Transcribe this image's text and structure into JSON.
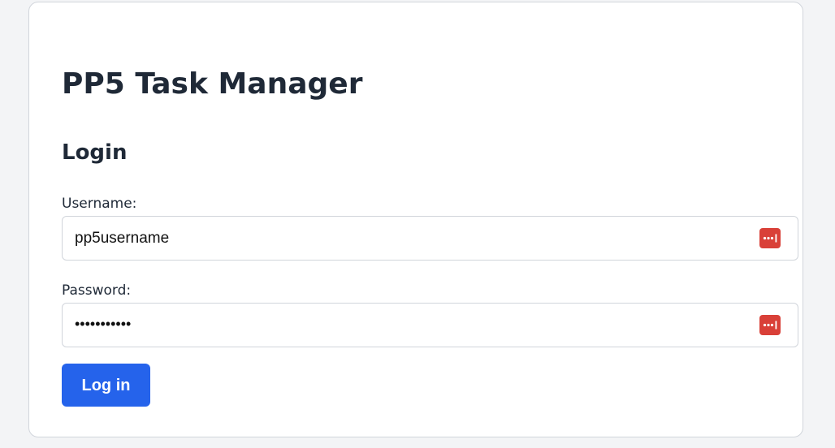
{
  "app": {
    "title": "PP5 Task Manager"
  },
  "login": {
    "heading": "Login",
    "username_label": "Username:",
    "username_value": "pp5username",
    "password_label": "Password:",
    "password_value": "•••••••••••",
    "submit_label": "Log in"
  },
  "icons": {
    "password_manager": "password-manager-icon"
  },
  "colors": {
    "accent": "#2563eb",
    "password_manager_icon": "#d94038",
    "text": "#1f2937",
    "background": "#f3f4f6",
    "card": "#ffffff",
    "border": "#d1d5db"
  }
}
